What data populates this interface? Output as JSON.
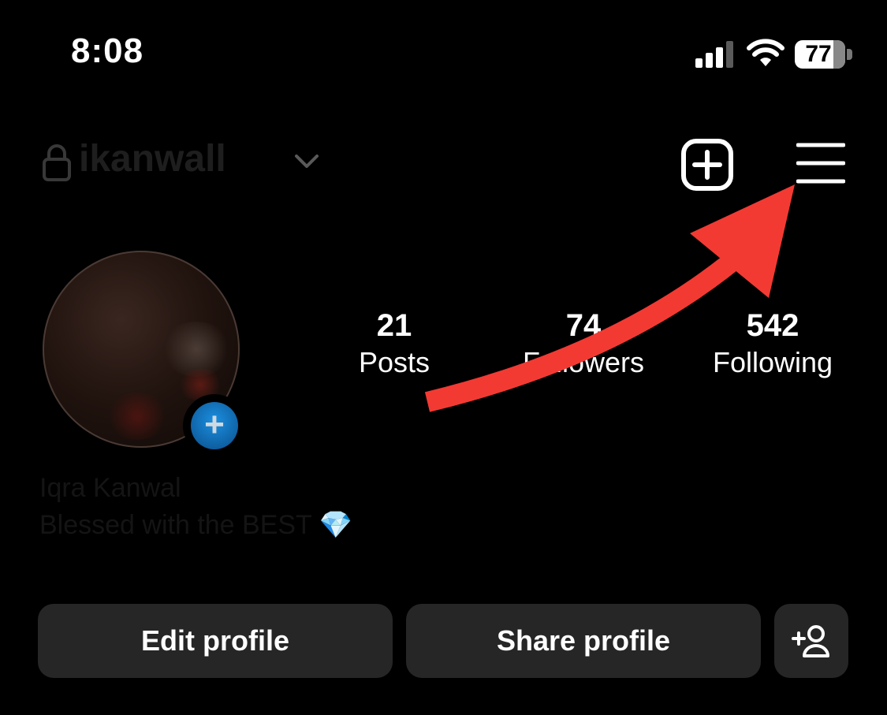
{
  "status_bar": {
    "time": "8:08",
    "battery": "77",
    "battery_level": 0.77
  },
  "header": {
    "username": "ikanwall",
    "icons": [
      "lock-icon",
      "chevron-down-icon",
      "new-post-icon",
      "menu-icon"
    ]
  },
  "profile": {
    "stats": [
      {
        "value": "21",
        "label": "Posts"
      },
      {
        "value": "74",
        "label": "Followers"
      },
      {
        "value": "542",
        "label": "Following"
      }
    ],
    "full_name": "Iqra Kanwal",
    "bio": "Blessed with the BEST",
    "bio_emoji": "💎"
  },
  "buttons": {
    "edit_profile": "Edit profile",
    "share_profile": "Share profile",
    "add_user_icon": "add-person-icon"
  },
  "colors": {
    "background": "#000000",
    "button_bg": "#262626",
    "annotation_arrow": "#f23a33",
    "avatar_badge": "#1b8fe0"
  }
}
